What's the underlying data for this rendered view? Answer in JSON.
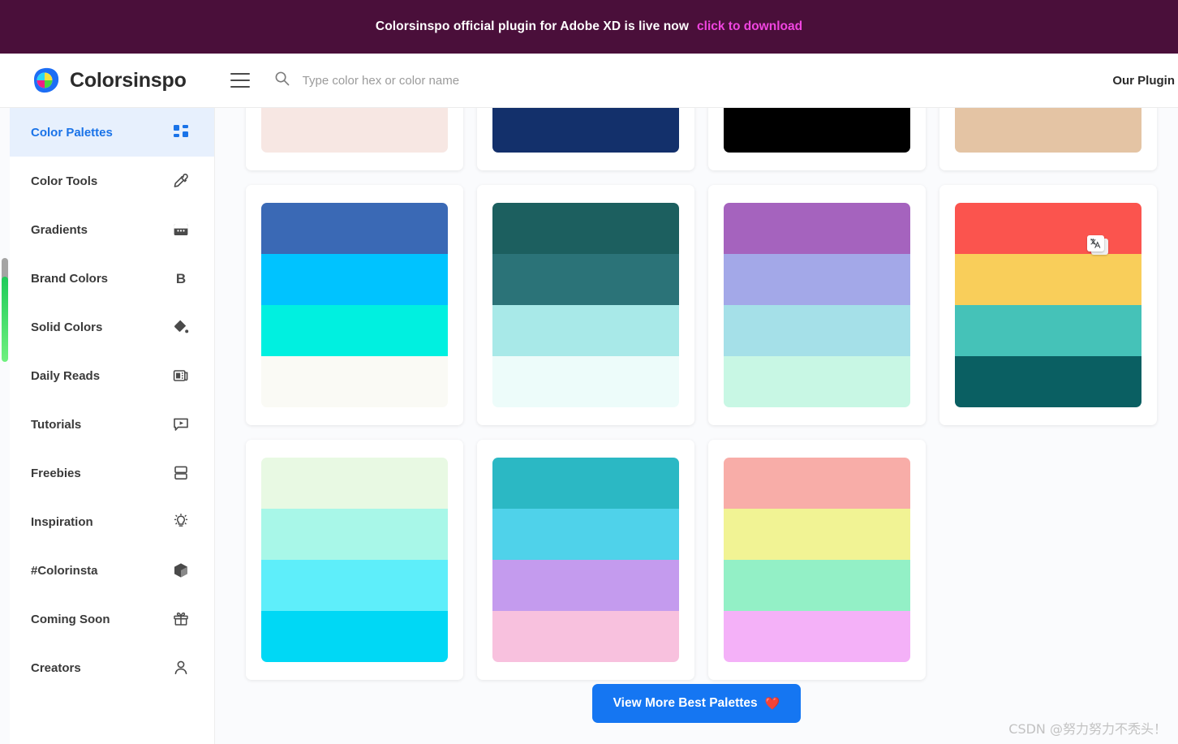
{
  "banner": {
    "message": "Colorsinspo official plugin for Adobe XD is live now",
    "link_label": "click to download",
    "bg_color": "#4a0f3a",
    "link_color": "#f045e0"
  },
  "header": {
    "logo_text": "Colorsinspo",
    "menu_icon": "hamburger-icon",
    "search": {
      "icon": "search-icon",
      "value": "",
      "placeholder": "Type color hex or color name"
    },
    "nav_right": "Our Plugin"
  },
  "sidebar": {
    "items": [
      {
        "label": "Color Palettes",
        "icon": "grid-icon",
        "active": true
      },
      {
        "label": "Color Tools",
        "icon": "eyedropper-icon",
        "active": false
      },
      {
        "label": "Gradients",
        "icon": "gradient-icon",
        "active": false
      },
      {
        "label": "Brand Colors",
        "icon": "bold-b-icon",
        "active": false
      },
      {
        "label": "Solid Colors",
        "icon": "paint-bucket-icon",
        "active": false
      },
      {
        "label": "Daily Reads",
        "icon": "news-icon",
        "active": false
      },
      {
        "label": "Tutorials",
        "icon": "video-play-icon",
        "active": false
      },
      {
        "label": "Freebies",
        "icon": "stacked-boxes-icon",
        "active": false
      },
      {
        "label": "Inspiration",
        "icon": "lightbulb-icon",
        "active": false
      },
      {
        "label": "#Colorinsta",
        "icon": "cube-icon",
        "active": false
      },
      {
        "label": "Coming Soon",
        "icon": "gift-icon",
        "active": false
      },
      {
        "label": "Creators",
        "icon": "user-icon",
        "active": false
      }
    ],
    "active_color": "#1a73e8",
    "active_bg": "#e7f0fd"
  },
  "palettes": {
    "row_top_partial": [
      {
        "colors": [
          "#f7e7e3"
        ]
      },
      {
        "colors": [
          "#13306b"
        ]
      },
      {
        "colors": [
          "#000000"
        ]
      },
      {
        "colors": [
          "#e4c4a4"
        ]
      }
    ],
    "row_middle": [
      {
        "colors": [
          "#3a69b5",
          "#00c3ff",
          "#00f0e0",
          "#fafaf5"
        ]
      },
      {
        "colors": [
          "#1c5f5f",
          "#2b7378",
          "#a8e9e8",
          "#edfcfa"
        ]
      },
      {
        "colors": [
          "#a563be",
          "#a3a8e8",
          "#a5e0e8",
          "#c8f7e4"
        ]
      },
      {
        "colors": [
          "#fb544e",
          "#f9ce5a",
          "#45c2b8",
          "#0a5f62"
        ],
        "badge": "translate-icon"
      }
    ],
    "row_bottom": [
      {
        "colors": [
          "#e8f9e3",
          "#a8f7e8",
          "#5eeefa",
          "#00d8f5"
        ]
      },
      {
        "colors": [
          "#2bb8c4",
          "#4fd2ea",
          "#c49bee",
          "#f8c1de"
        ]
      },
      {
        "colors": [
          "#f8ada8",
          "#f1f394",
          "#93f0c6",
          "#f4b1f8"
        ]
      }
    ]
  },
  "footer": {
    "view_more_label": "View More Best Palettes",
    "view_more_icon": "heart-icon",
    "button_color": "#1576f2"
  },
  "watermark": "CSDN @努力努力不秃头！"
}
